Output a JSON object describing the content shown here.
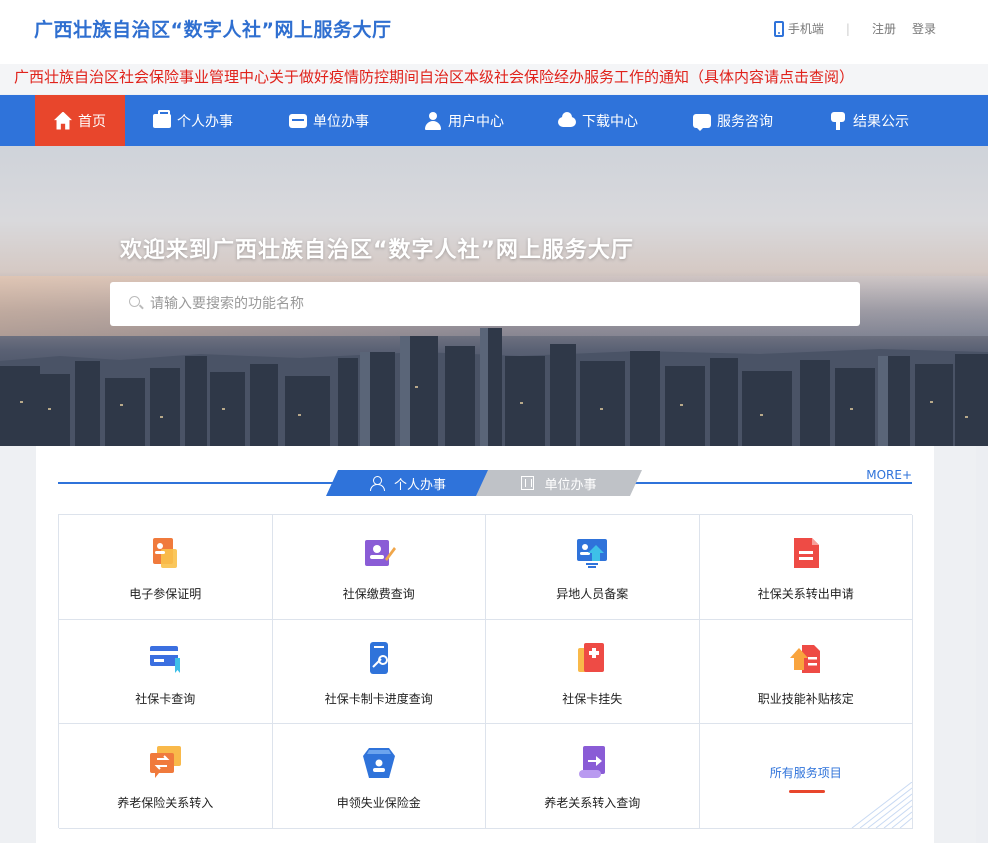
{
  "header": {
    "title": "广西壮族自治区“数字人社”网上服务大厅",
    "mobile": "手机端",
    "separator": "|",
    "register": "注册",
    "login": "登录"
  },
  "notice": {
    "text": "广西壮族自治区社会保险事业管理中心关于做好疫情防控期间自治区本级社会保险经办服务工作的通知（具体内容请点击查阅）"
  },
  "nav": {
    "items": [
      {
        "label": "首页",
        "icon": "home-icon",
        "active": true
      },
      {
        "label": "个人办事",
        "icon": "briefcase-icon"
      },
      {
        "label": "单位办事",
        "icon": "card-icon"
      },
      {
        "label": "用户中心",
        "icon": "user-icon"
      },
      {
        "label": "下载中心",
        "icon": "cloud-download-icon"
      },
      {
        "label": "服务咨询",
        "icon": "chat-icon"
      },
      {
        "label": "结果公示",
        "icon": "signpost-icon"
      }
    ]
  },
  "banner": {
    "title": "欢迎来到广西壮族自治区“数字人社”网上服务大厅"
  },
  "search": {
    "placeholder": "请输入要搜索的功能名称"
  },
  "services": {
    "tab_personal": "个人办事",
    "tab_unit": "单位办事",
    "more": "MORE+",
    "items": [
      {
        "label": "电子参保证明",
        "icon": "certificate-icon"
      },
      {
        "label": "社保缴费查询",
        "icon": "payment-query-icon"
      },
      {
        "label": "异地人员备案",
        "icon": "relocation-record-icon"
      },
      {
        "label": "社保关系转出申请",
        "icon": "transfer-out-doc-icon"
      },
      {
        "label": "社保卡查询",
        "icon": "social-card-icon"
      },
      {
        "label": "社保卡制卡进度查询",
        "icon": "card-progress-icon"
      },
      {
        "label": "社保卡挂失",
        "icon": "card-loss-icon"
      },
      {
        "label": "职业技能补贴核定",
        "icon": "skill-subsidy-icon"
      },
      {
        "label": "养老保险关系转入",
        "icon": "pension-transfer-icon"
      },
      {
        "label": "申领失业保险金",
        "icon": "unemployment-icon"
      },
      {
        "label": "养老关系转入查询",
        "icon": "pension-query-icon"
      }
    ],
    "all_services": "所有服务项目"
  },
  "colors": {
    "primary": "#2f73da",
    "active_nav": "#e8462c",
    "notice_text": "#e0221b",
    "title": "#2f6fd0"
  }
}
